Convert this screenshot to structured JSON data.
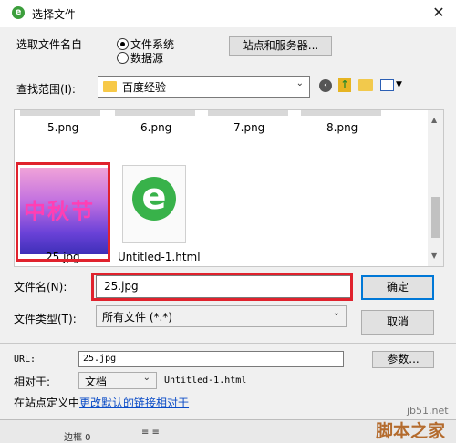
{
  "title_bar": {
    "title": "选择文件",
    "app_icon": "dreamweaver-icon",
    "close": "✕"
  },
  "source": {
    "label": "选取文件名自",
    "options": [
      "文件系统",
      "数据源"
    ],
    "selected": "文件系统",
    "sites_button": "站点和服务器..."
  },
  "look_in": {
    "label": "查找范围(I):",
    "value": "百度经验"
  },
  "files_row1": [
    "5.png",
    "6.png",
    "7.png",
    "8.png"
  ],
  "files_row2": [
    {
      "name": "25.jpg",
      "thumb_text": "中秋节",
      "selected": true
    },
    {
      "name": "Untitled-1.html",
      "thumb_text": "e",
      "selected": false
    }
  ],
  "filename": {
    "label": "文件名(N):",
    "value": "25.jpg",
    "ok": "确定"
  },
  "filetype": {
    "label": "文件类型(T):",
    "value": "所有文件 (*.*)",
    "cancel": "取消"
  },
  "url": {
    "label": "URL:",
    "value": "25.jpg",
    "params_button": "参数..."
  },
  "relative": {
    "label": "相对于:",
    "value": "文档",
    "document": "Untitled-1.html"
  },
  "site_hint": {
    "prefix": "在站点定义中",
    "link": "更改默认的链接相对于"
  },
  "watermark": {
    "site": "jb51.net",
    "name": "脚本之家"
  },
  "bottom_strip": {
    "text": "边框 0"
  },
  "colors": {
    "highlight_red": "#e0222d",
    "link_blue": "#0b4cc7",
    "accent": "#0078d7"
  }
}
